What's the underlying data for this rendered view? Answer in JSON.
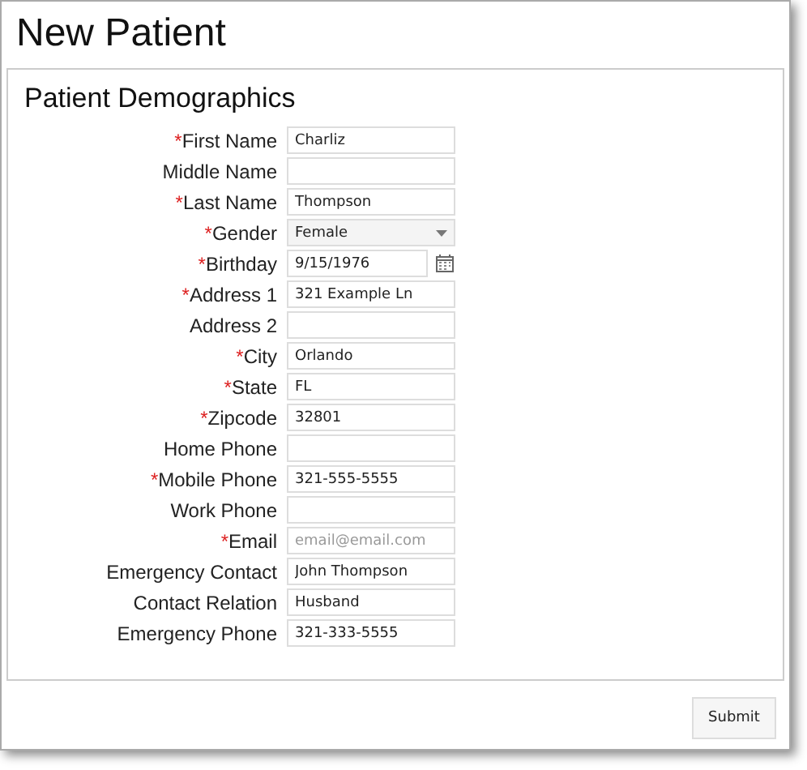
{
  "window": {
    "title": "New Patient"
  },
  "section": {
    "title": "Patient Demographics"
  },
  "fields": [
    {
      "label": "First Name",
      "required_mark": "*",
      "kind": "text",
      "value": "Charliz"
    },
    {
      "label": "Middle Name",
      "kind": "text"
    },
    {
      "label": "Last Name",
      "required_mark": "*",
      "kind": "text",
      "value": "Thompson"
    },
    {
      "label": "Gender",
      "required_mark": "*",
      "kind": "select",
      "value": "Female"
    },
    {
      "label": "Birthday",
      "required_mark": "*",
      "kind": "date",
      "value": "9/15/1976"
    },
    {
      "label": "Address 1",
      "required_mark": "*",
      "kind": "text",
      "value": "321 Example Ln"
    },
    {
      "label": "Address 2",
      "kind": "text"
    },
    {
      "label": "City",
      "required_mark": "*",
      "kind": "text",
      "value": "Orlando"
    },
    {
      "label": "State",
      "required_mark": "*",
      "kind": "text",
      "value": "FL"
    },
    {
      "label": "Zipcode",
      "required_mark": "*",
      "kind": "text",
      "value": "32801"
    },
    {
      "label": "Home Phone",
      "kind": "text"
    },
    {
      "label": "Mobile Phone",
      "required_mark": "*",
      "kind": "text",
      "value": "321-555-5555"
    },
    {
      "label": "Work Phone",
      "kind": "text"
    },
    {
      "label": "Email",
      "required_mark": "*",
      "kind": "text",
      "placeholder": "email@email.com"
    },
    {
      "label": "Emergency Contact",
      "kind": "text",
      "value": "John Thompson"
    },
    {
      "label": "Contact Relation",
      "kind": "text",
      "value": "Husband"
    },
    {
      "label": "Emergency Phone",
      "kind": "text",
      "value": "321-333-5555"
    }
  ],
  "buttons": [
    "Submit"
  ]
}
